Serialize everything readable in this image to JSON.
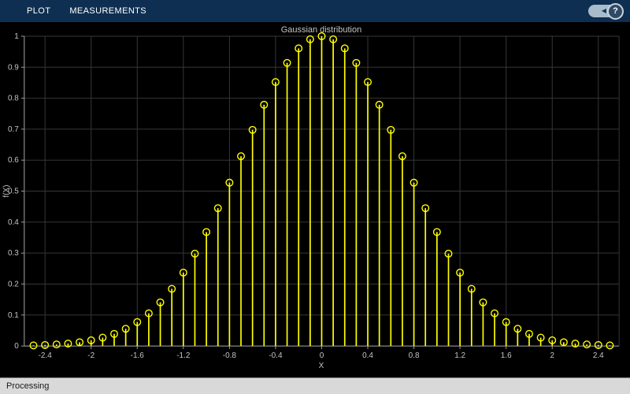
{
  "toolbar": {
    "tabs": [
      {
        "label": "PLOT"
      },
      {
        "label": "MEASUREMENTS"
      }
    ],
    "help_label": "?"
  },
  "statusbar": {
    "text": "Processing"
  },
  "colors": {
    "toolbar_bg": "#0e2f52",
    "plot_bg": "#000000",
    "stem": "#ffff00",
    "grid": "#363636",
    "axis": "#9a9a9a",
    "tick_text": "#c4c4c4",
    "title_text": "#c4c4c4",
    "statusbar_bg": "#d9d9d9"
  },
  "chart_data": {
    "type": "stem",
    "title": "Gaussian distribution",
    "xlabel": "X",
    "ylabel": "f(X)",
    "xlim": [
      -2.58,
      2.58
    ],
    "ylim": [
      0,
      1
    ],
    "grid": true,
    "marker": "circle",
    "series_color": "#ffff00",
    "x_ticks": {
      "values": [
        -2.4,
        -2,
        -1.6,
        -1.2,
        -0.8,
        -0.4,
        0,
        0.4,
        0.8,
        1.2,
        1.6,
        2,
        2.4
      ],
      "labels": [
        "-2.4",
        "-2",
        "-1.6",
        "-1.2",
        "-0.8",
        "-0.4",
        "0",
        "0.4",
        "0.8",
        "1.2",
        "1.6",
        "2",
        "2.4"
      ]
    },
    "y_ticks": {
      "values": [
        0,
        0.1,
        0.2,
        0.3,
        0.4,
        0.5,
        0.6,
        0.7,
        0.8,
        0.9,
        1
      ],
      "labels": [
        "0",
        "0.1",
        "0.2",
        "0.3",
        "0.4",
        "0.5",
        "0.6",
        "0.7",
        "0.8",
        "0.9",
        "1"
      ]
    },
    "x": [
      -2.5,
      -2.4,
      -2.3,
      -2.2,
      -2.1,
      -2,
      -1.9,
      -1.8,
      -1.7,
      -1.6,
      -1.5,
      -1.4,
      -1.3,
      -1.2,
      -1.1,
      -1,
      -0.9,
      -0.8,
      -0.7,
      -0.6,
      -0.5,
      -0.4,
      -0.3,
      -0.2,
      -0.1,
      0,
      0.1,
      0.2,
      0.3,
      0.4,
      0.5,
      0.6,
      0.7,
      0.8,
      0.9,
      1,
      1.1,
      1.2,
      1.3,
      1.4,
      1.5,
      1.6,
      1.7,
      1.8,
      1.9,
      2,
      2.1,
      2.2,
      2.3,
      2.4,
      2.5
    ],
    "values": [
      0.0019,
      0.0032,
      0.005,
      0.0079,
      0.0121,
      0.0183,
      0.027,
      0.0392,
      0.0556,
      0.0773,
      0.1054,
      0.1409,
      0.1845,
      0.2369,
      0.2982,
      0.3679,
      0.4449,
      0.5273,
      0.6126,
      0.6977,
      0.7788,
      0.8521,
      0.9139,
      0.9608,
      0.99,
      1,
      0.99,
      0.9608,
      0.9139,
      0.8521,
      0.7788,
      0.6977,
      0.6126,
      0.5273,
      0.4449,
      0.3679,
      0.2982,
      0.2369,
      0.1845,
      0.1409,
      0.1054,
      0.0773,
      0.0556,
      0.0392,
      0.027,
      0.0183,
      0.0121,
      0.0079,
      0.005,
      0.0032,
      0.0019
    ]
  }
}
